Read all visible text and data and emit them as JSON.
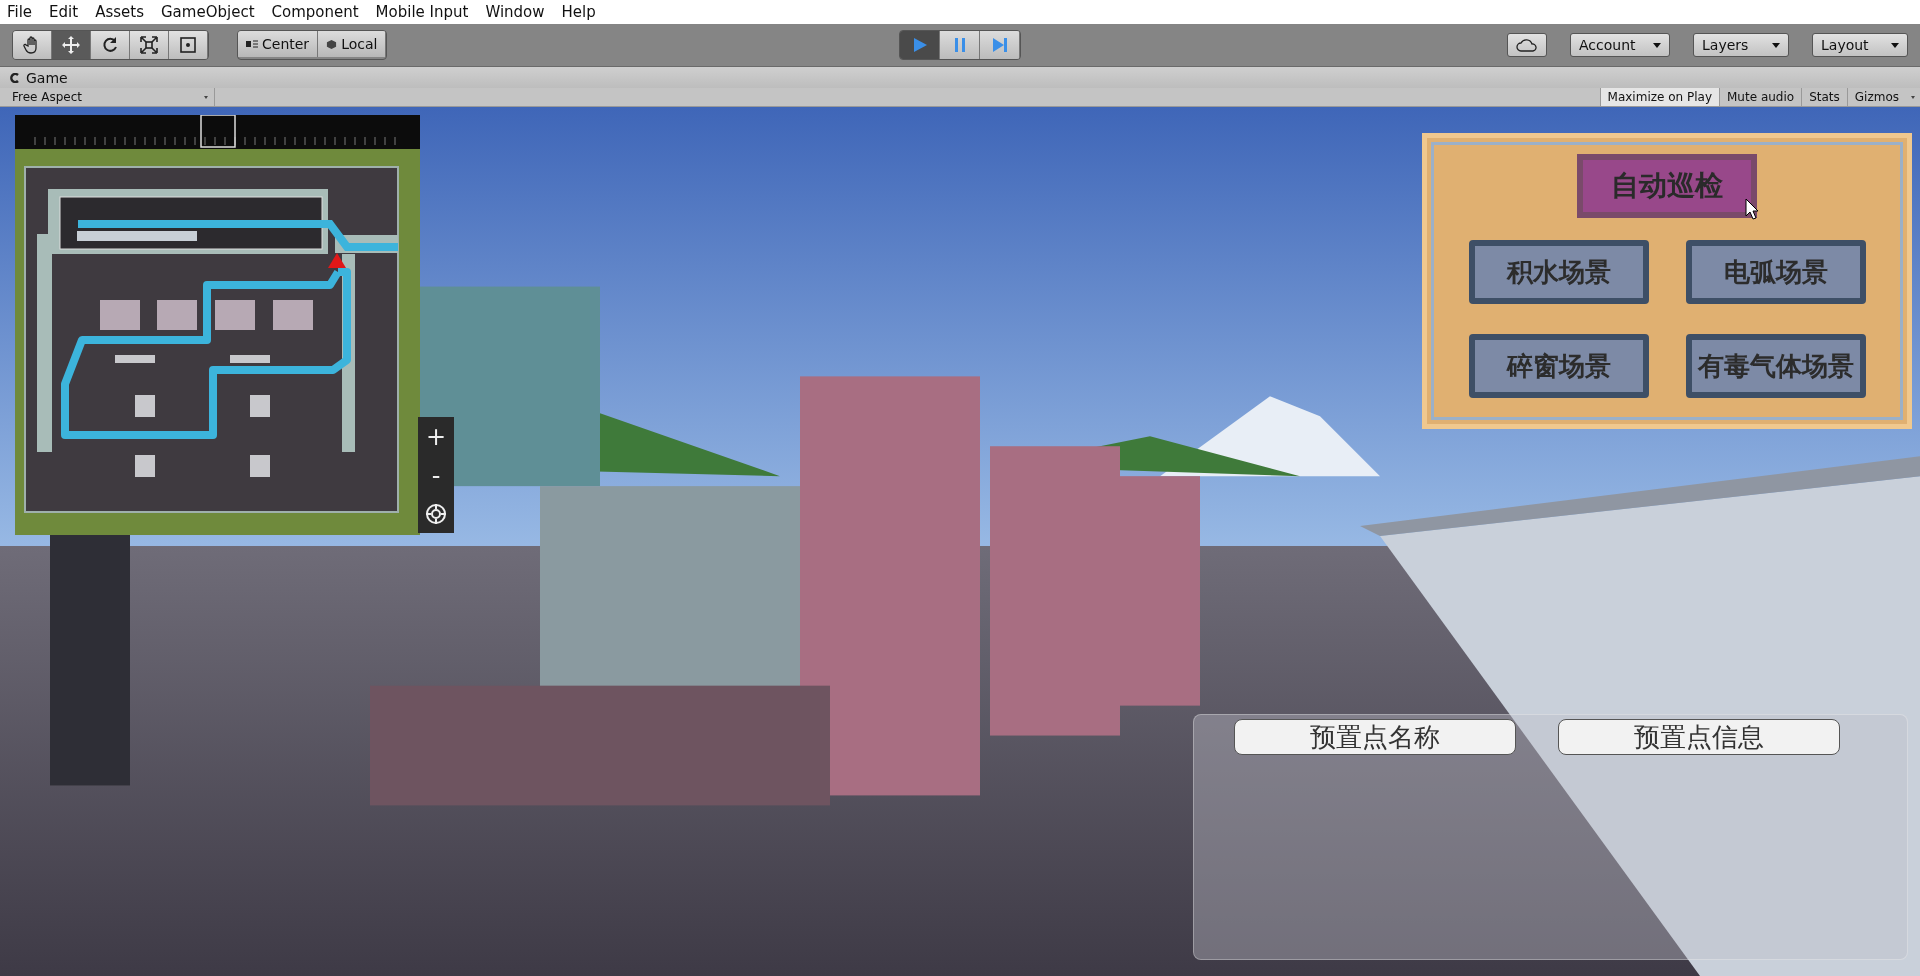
{
  "menu_bar": [
    "File",
    "Edit",
    "Assets",
    "GameObject",
    "Component",
    "Mobile Input",
    "Window",
    "Help"
  ],
  "toolbar": {
    "tools": [
      {
        "kind": "hand",
        "selected": false
      },
      {
        "kind": "move",
        "selected": true
      },
      {
        "kind": "rotate",
        "selected": false
      },
      {
        "kind": "scale",
        "selected": false
      },
      {
        "kind": "rect",
        "selected": false
      }
    ],
    "pivot_buttons": [
      {
        "kind": "center",
        "label": "Center"
      },
      {
        "kind": "local",
        "label": "Local"
      }
    ],
    "playback": [
      {
        "kind": "play",
        "on": true
      },
      {
        "kind": "pause",
        "on": false
      },
      {
        "kind": "step",
        "on": false
      }
    ],
    "account": "Account",
    "layers": "Layers",
    "layout": "Layout"
  },
  "game_tab": {
    "title": "Game",
    "aspect": "Free Aspect",
    "view_toggles": [
      {
        "label": "Maximize on Play",
        "selected": true
      },
      {
        "label": "Mute audio",
        "selected": false
      },
      {
        "label": "Stats",
        "selected": false
      },
      {
        "label": "Gizmos",
        "selected": false
      }
    ]
  },
  "minimap": {
    "zoom_in": "+",
    "zoom_out": "-"
  },
  "scenario_panel": {
    "primary": "自动巡检",
    "buttons": [
      "积水场景",
      "电弧场景",
      "碎窗场景",
      "有毒气体场景"
    ]
  },
  "info_panel": {
    "columns": [
      "预置点名称",
      "预置点信息"
    ]
  }
}
